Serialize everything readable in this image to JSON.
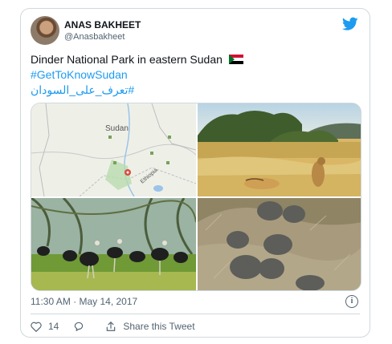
{
  "author": {
    "name": "ANAS BAKHEET",
    "handle": "@Anasbakheet"
  },
  "tweet": {
    "line1": "Dinder National Park in eastern Sudan",
    "line2": "#GetToKnowSudan",
    "line3": "#تعرف_على_السودان"
  },
  "map": {
    "country_label": "Sudan",
    "neighbor_label": "Ethiopia"
  },
  "footer": {
    "timestamp": "11:30 AM · May 14, 2017",
    "like_count": "14",
    "share_label": "Share this Tweet"
  },
  "colors": {
    "accent": "#1d9bf0",
    "border": "#cfd9de",
    "muted": "#536471"
  },
  "icons": [
    "twitter-bird-icon",
    "sudan-flag-icon",
    "info-icon",
    "heart-icon",
    "reply-icon",
    "share-icon"
  ]
}
